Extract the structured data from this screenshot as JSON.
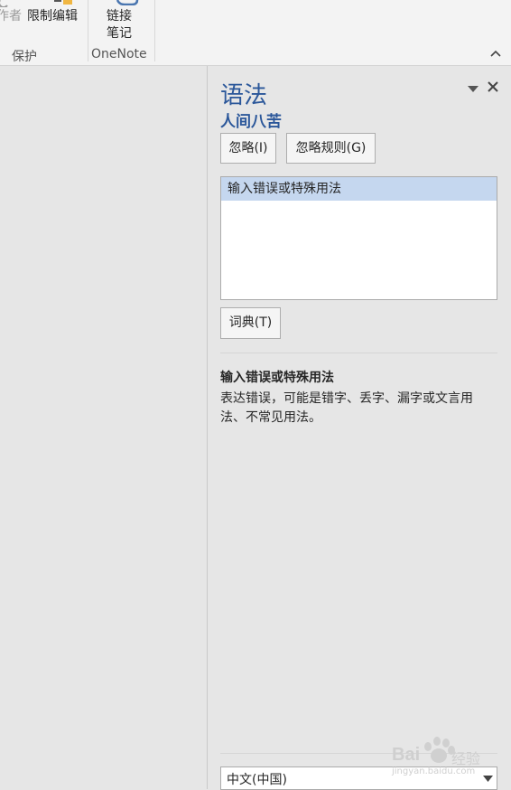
{
  "ribbon": {
    "author_partial": "作者",
    "restrict_edit": "限制编辑",
    "link_notes_line1": "链接",
    "link_notes_line2": "笔记",
    "group_protect": "保护",
    "group_onenote": "OneNote"
  },
  "pane": {
    "title": "语法",
    "subtitle": "人间八苦",
    "ignore_button": "忽略(I)",
    "ignore_rule_button": "忽略规则(G)",
    "suggestions": [
      "输入错误或特殊用法"
    ],
    "dictionary_button": "词典(T)",
    "explanation_title": "输入错误或特殊用法",
    "explanation_text": "表达错误，可能是错字、丢字、漏字或文言用法、不常见用法。",
    "language": "中文(中国)"
  },
  "watermark": {
    "brand": "Bai",
    "brand_suffix": "经验",
    "url": "jingyan.baidu.com"
  },
  "colors": {
    "accent": "#2b579a",
    "selection": "#c5d7ef",
    "pane_bg": "#e6e6e6"
  }
}
